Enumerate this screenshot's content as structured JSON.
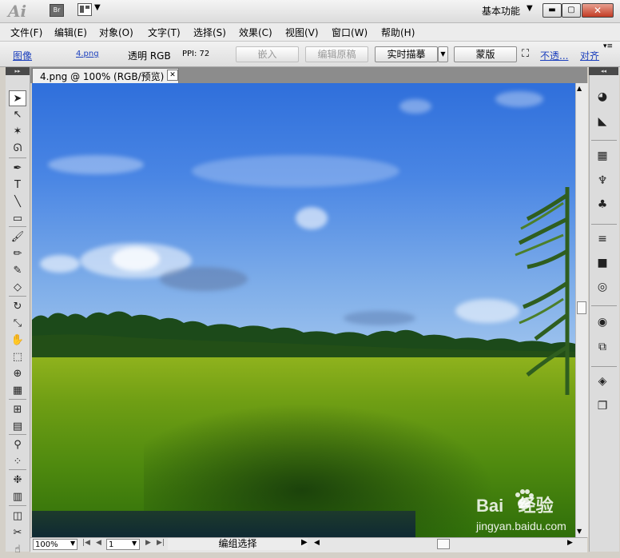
{
  "titlebar": {
    "logo": "Ai",
    "bridge_label": "Br",
    "workspace_label": "基本功能",
    "workspace_arrow": "▼",
    "layout_arrow": "▼",
    "min_glyph": "▬",
    "max_glyph": "▢",
    "close_glyph": "✕"
  },
  "menubar": {
    "items": [
      {
        "label": "文件(F)"
      },
      {
        "label": "编辑(E)"
      },
      {
        "label": "对象(O)"
      },
      {
        "label": "文字(T)"
      },
      {
        "label": "选择(S)"
      },
      {
        "label": "效果(C)"
      },
      {
        "label": "视图(V)"
      },
      {
        "label": "窗口(W)"
      },
      {
        "label": "帮助(H)"
      }
    ]
  },
  "controlbar": {
    "object_type": "图像",
    "file_name": "4.png",
    "mode": "透明 RGB",
    "ppi": "PPI: 72",
    "embed_label": "嵌入",
    "edit_original_label": "编辑原稿",
    "live_trace_label": "实时描摹",
    "live_trace_arrow": "▼",
    "mask_label": "蒙版",
    "opacity_link": "不透...",
    "align_link": "对齐",
    "panel_menu_glyph": "▾≡"
  },
  "document": {
    "tab_label": "4.png @ 100% (RGB/预览)",
    "close_glyph": "✕"
  },
  "statusbar": {
    "zoom": "100%",
    "page": "1",
    "status_text": "编组选择",
    "status_arrow": "▶"
  },
  "watermark": {
    "brand": "Bai   经验",
    "url": "jingyan.baidu.com"
  },
  "tools": [
    {
      "icon": "selection-icon",
      "glyph": "➤"
    },
    {
      "icon": "direct-selection-icon",
      "glyph": "↖"
    },
    {
      "icon": "magic-wand-icon",
      "glyph": "✶"
    },
    {
      "icon": "lasso-icon",
      "glyph": "ᘏ"
    },
    {
      "icon": "pen-icon",
      "glyph": "✒"
    },
    {
      "icon": "type-icon",
      "glyph": "T"
    },
    {
      "icon": "line-icon",
      "glyph": "╲"
    },
    {
      "icon": "rectangle-icon",
      "glyph": "▭"
    },
    {
      "icon": "paintbrush-icon",
      "glyph": "🖌"
    },
    {
      "icon": "pencil-icon",
      "glyph": "✏"
    },
    {
      "icon": "blob-brush-icon",
      "glyph": "✎"
    },
    {
      "icon": "eraser-icon",
      "glyph": "◇"
    },
    {
      "icon": "rotate-icon",
      "glyph": "↻"
    },
    {
      "icon": "scale-icon",
      "glyph": "⤡"
    },
    {
      "icon": "warp-icon",
      "glyph": "✋"
    },
    {
      "icon": "free-transform-icon",
      "glyph": "⬚"
    },
    {
      "icon": "shape-builder-icon",
      "glyph": "⊕"
    },
    {
      "icon": "perspective-grid-icon",
      "glyph": "▦"
    },
    {
      "icon": "mesh-icon",
      "glyph": "⊞"
    },
    {
      "icon": "gradient-icon",
      "glyph": "▤"
    },
    {
      "icon": "eyedropper-icon",
      "glyph": "⚲"
    },
    {
      "icon": "blend-icon",
      "glyph": "⁘"
    },
    {
      "icon": "symbol-sprayer-icon",
      "glyph": "❉"
    },
    {
      "icon": "column-graph-icon",
      "glyph": "▥"
    },
    {
      "icon": "artboard-icon",
      "glyph": "◫"
    },
    {
      "icon": "slice-icon",
      "glyph": "✂"
    },
    {
      "icon": "hand-icon",
      "glyph": "☝"
    }
  ],
  "panels": [
    {
      "icon": "color-panel-icon",
      "glyph": "◕"
    },
    {
      "icon": "color-guide-icon",
      "glyph": "◣"
    },
    {
      "icon": "swatches-icon",
      "glyph": "▦"
    },
    {
      "icon": "brushes-icon",
      "glyph": "♆"
    },
    {
      "icon": "symbols-icon",
      "glyph": "♣"
    },
    {
      "icon": "stroke-icon",
      "glyph": "≡"
    },
    {
      "icon": "gradient-panel-icon",
      "glyph": "■"
    },
    {
      "icon": "transparency-icon",
      "glyph": "◎"
    },
    {
      "icon": "appearance-icon",
      "glyph": "◉"
    },
    {
      "icon": "graphic-styles-icon",
      "glyph": "⧉"
    },
    {
      "icon": "layers-icon",
      "glyph": "◈"
    },
    {
      "icon": "artboards-panel-icon",
      "glyph": "❐"
    }
  ],
  "colors": {
    "accent_link": "#1b3fbd",
    "close_button": "#c23b24"
  }
}
